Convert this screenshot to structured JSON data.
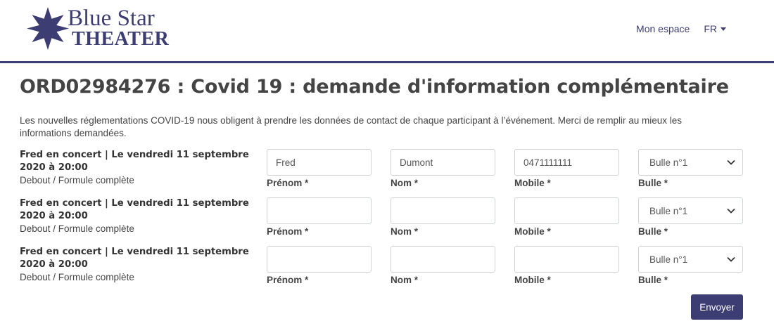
{
  "brand": {
    "line1": "Blue Star",
    "line2": "THEATER",
    "color": "#3c3d73"
  },
  "nav": {
    "my_space": "Mon espace",
    "language": "FR"
  },
  "page": {
    "title": "ORD02984276 : Covid 19 : demande d'information complémentaire",
    "intro": "Les nouvelles réglementations COVID-19 nous obligent à prendre les données de contact de chaque participant à l’événement. Merci de remplir au mieux les informations demandées."
  },
  "labels": {
    "first_name": "Prénom *",
    "last_name": "Nom *",
    "mobile": "Mobile *",
    "bubble": "Bulle *"
  },
  "participants": [
    {
      "event": "Fred en concert | Le vendredi 11 septembre 2020 à 20:00",
      "formula": "Debout / Formule complète",
      "first_name": "Fred",
      "last_name": "Dumont",
      "mobile": "0471111111",
      "bubble": "Bulle n°1"
    },
    {
      "event": "Fred en concert | Le vendredi 11 septembre 2020 à 20:00",
      "formula": "Debout / Formule complète",
      "first_name": "",
      "last_name": "",
      "mobile": "",
      "bubble": "Bulle n°1"
    },
    {
      "event": "Fred en concert | Le vendredi 11 septembre 2020 à 20:00",
      "formula": "Debout / Formule complète",
      "first_name": "",
      "last_name": "",
      "mobile": "",
      "bubble": "Bulle n°1"
    }
  ],
  "submit_label": "Envoyer"
}
